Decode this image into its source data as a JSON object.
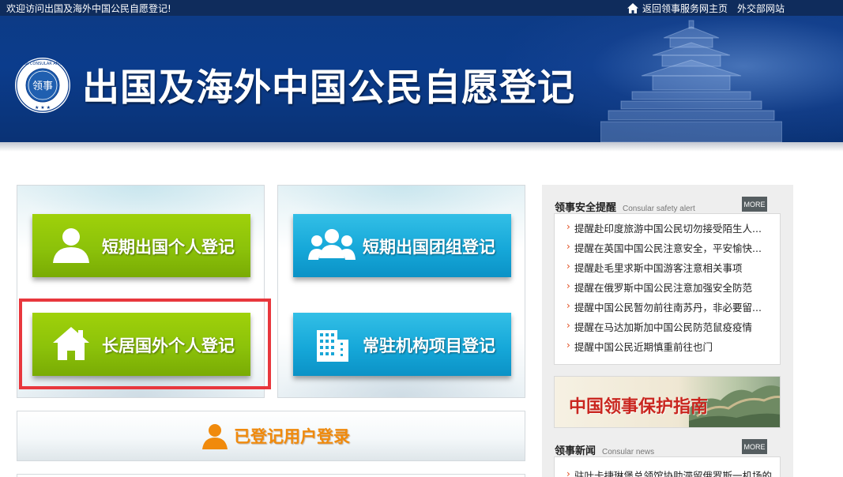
{
  "topbar": {
    "welcome": "欢迎访问出国及海外中国公民自愿登记!",
    "home_link": "返回领事服务网主页",
    "mfa_link": "外交部网站"
  },
  "banner": {
    "title": "出国及海外中国公民自愿登记",
    "emblem_text": "CHINA CONSULAR AFFAIRS",
    "emblem_center": "领事"
  },
  "register_buttons": {
    "short_personal": "短期出国个人登记",
    "short_group": "短期出国团组登记",
    "long_personal": "长居国外个人登记",
    "resident_org": "常驻机构项目登记"
  },
  "login": {
    "label": "已登记用户登录"
  },
  "sidebar": {
    "alerts": {
      "title": "领事安全提醒",
      "subtitle": "Consular safety alert",
      "more": "MORE",
      "items": [
        "提醒赴印度旅游中国公民切勿接受陌生人...",
        "提醒在英国中国公民注意安全，平安愉快...",
        "提醒赴毛里求斯中国游客注意相关事项",
        "提醒在俄罗斯中国公民注意加强安全防范",
        "提醒中国公民暂勿前往南苏丹，非必要留...",
        "提醒在马达加斯加中国公民防范鼠疫疫情",
        "提醒中国公民近期慎重前往也门"
      ]
    },
    "guide": {
      "label": "中国领事保护指南"
    },
    "news": {
      "title": "领事新闻",
      "subtitle": "Consular news",
      "more": "MORE",
      "items": [
        "驻叶卡捷琳堡总领馆协助滞留俄罗斯一机场的"
      ]
    }
  },
  "colors": {
    "topbar_bg": "#0f2c5c",
    "banner_bg": "#0b3c8c",
    "green_button": "#8cc20a",
    "blue_button": "#16a8d9",
    "login_text": "#f08a0c",
    "highlight": "#e8373d",
    "guide_text": "#c9261f"
  }
}
